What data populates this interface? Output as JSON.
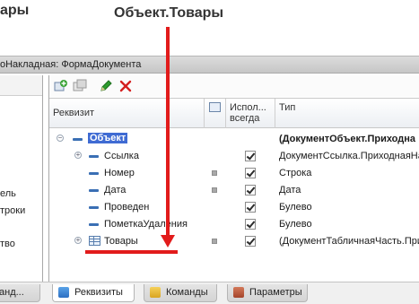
{
  "header_fragment": "ары",
  "annotation": "Объект.Товары",
  "title_bar": {
    "text": "оНакладная: ФормаДокумента"
  },
  "left_panel": {
    "lines": [
      "ель",
      "троки",
      "тво"
    ]
  },
  "toolbar": {
    "buttons": [
      "add-icon",
      "copy-icon",
      "edit-icon",
      "delete-icon"
    ],
    "delete_color": "#d42020",
    "edit_color": "#2e9b2e"
  },
  "table": {
    "columns": {
      "name": "Реквизит",
      "use_always": "Испол... всегда",
      "type": "Тип"
    },
    "rows": [
      {
        "name": "Объект",
        "type": "(ДокументОбъект.Приходна",
        "selected": true,
        "expander": "−",
        "has_square": false,
        "checked": null
      },
      {
        "name": "Ссылка",
        "type": "ДокументСсылка.ПриходнаяНа",
        "expander": "+",
        "has_square": false,
        "checked": true
      },
      {
        "name": "Номер",
        "type": "Строка",
        "expander": "",
        "has_square": true,
        "checked": true
      },
      {
        "name": "Дата",
        "type": "Дата",
        "expander": "",
        "has_square": true,
        "checked": true
      },
      {
        "name": "Проведен",
        "type": "Булево",
        "expander": "",
        "has_square": false,
        "checked": true
      },
      {
        "name": "ПометкаУдаления",
        "type": "Булево",
        "expander": "",
        "has_square": false,
        "checked": true
      },
      {
        "name": "Товары",
        "type": "(ДокументТабличнаяЧасть.При",
        "expander": "+",
        "has_square": true,
        "checked": true,
        "table_icon": true
      }
    ]
  },
  "tabs": [
    {
      "label": "анд...",
      "active": false
    },
    {
      "label": "Реквизиты",
      "active": true
    },
    {
      "label": "Команды",
      "active": false
    },
    {
      "label": "Параметры",
      "active": false
    }
  ],
  "colors": {
    "annotation_red": "#e21b1b",
    "selection_blue": "#3f6bd3"
  }
}
